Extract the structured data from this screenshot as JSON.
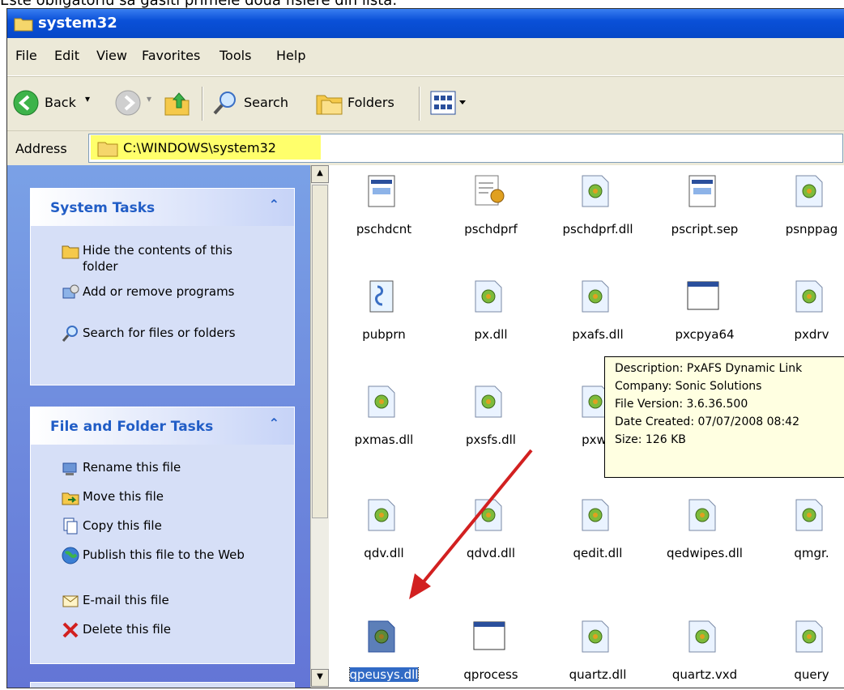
{
  "caption": "Este obligatoriu sa gasiti primele doua fisiere din lista:",
  "window": {
    "title": "system32"
  },
  "menu": [
    "File",
    "Edit",
    "View",
    "Favorites",
    "Tools",
    "Help"
  ],
  "toolbar": {
    "back_label": "Back",
    "search_label": "Search",
    "folders_label": "Folders"
  },
  "address": {
    "label": "Address",
    "value": "C:\\WINDOWS\\system32"
  },
  "system_tasks": {
    "title": "System Tasks",
    "items": [
      {
        "label": "Hide the contents of this folder",
        "icon": "folder-icon"
      },
      {
        "label": "Add or remove programs",
        "icon": "add-remove-icon"
      },
      {
        "label": "Search for files or folders",
        "icon": "search-icon"
      }
    ]
  },
  "file_tasks": {
    "title": "File and Folder Tasks",
    "items": [
      {
        "label": "Rename this file",
        "icon": "rename-icon"
      },
      {
        "label": "Move this file",
        "icon": "move-icon"
      },
      {
        "label": "Copy this file",
        "icon": "copy-icon"
      },
      {
        "label": "Publish this file to the Web",
        "icon": "globe-icon"
      },
      {
        "label": "E-mail this file",
        "icon": "email-icon"
      },
      {
        "label": "Delete this file",
        "icon": "delete-icon"
      }
    ]
  },
  "files": [
    [
      "pschdcnt",
      "pschdprf",
      "pschdprf.dll",
      "pscript.sep",
      "psnppag"
    ],
    [
      "pubprn",
      "px.dll",
      "pxafs.dll",
      "pxcpya64",
      "pxdrv"
    ],
    [
      "pxmas.dll",
      "pxsfs.dll",
      "pxwa",
      "",
      ""
    ],
    [
      "qdv.dll",
      "qdvd.dll",
      "qedit.dll",
      "qedwipes.dll",
      "qmgr."
    ],
    [
      "qpeusys.dll",
      "qprocess",
      "quartz.dll",
      "quartz.vxd",
      "query"
    ]
  ],
  "selected_file": "qpeusys.dll",
  "tooltip": {
    "lines": [
      "Description: PxAFS Dynamic Link",
      "Company: Sonic Solutions",
      "File Version: 3.6.36.500",
      "Date Created: 07/07/2008 08:42",
      "Size: 126 KB"
    ]
  },
  "colors": {
    "highlight": "#ffff6b",
    "arrow": "#d22020",
    "title_bar": "#0a50d8"
  }
}
